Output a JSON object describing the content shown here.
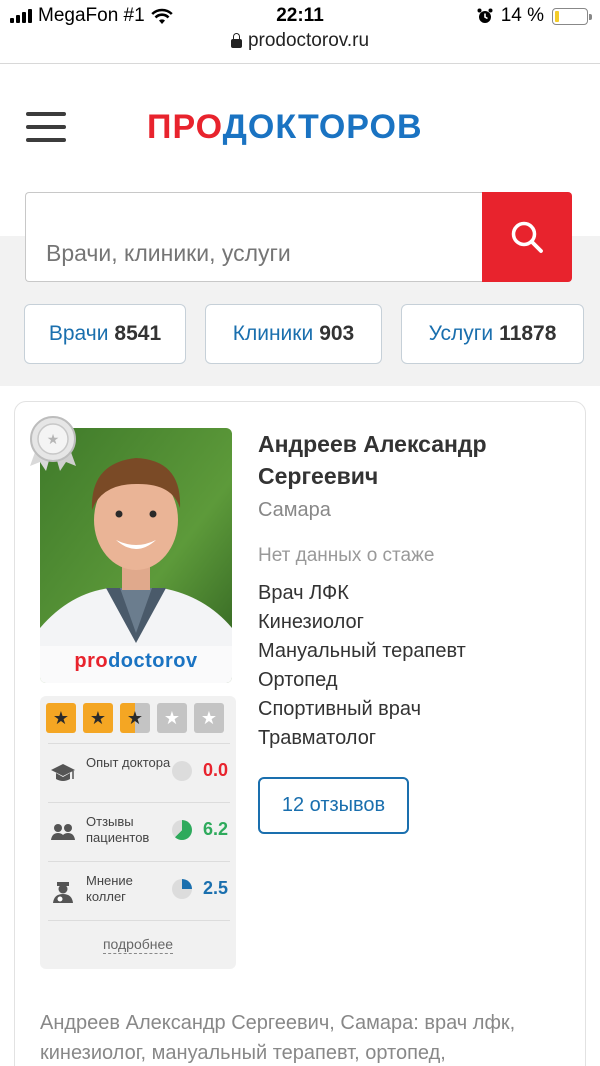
{
  "status_bar": {
    "carrier": "MegaFon #1",
    "time": "22:11",
    "battery": "14 %",
    "battery_level": 0.14,
    "url": "prodoctorov.ru"
  },
  "header": {
    "logo_part1": "ПРО",
    "logo_part2": "ДОКТОРОВ"
  },
  "search": {
    "placeholder": "Врачи, клиники, услуги"
  },
  "stats": [
    {
      "label": "Врачи",
      "count": "8541"
    },
    {
      "label": "Клиники",
      "count": "903"
    },
    {
      "label": "Услуги",
      "count": "11878"
    }
  ],
  "doctor": {
    "name": "Андреев Александр Сергеевич",
    "city": "Самара",
    "experience": "Нет данных о стаже",
    "specialties": [
      "Врач ЛФК",
      "Кинезиолог",
      "Мануальный терапевт",
      "Ортопед",
      "Спортивный врач",
      "Травматолог"
    ],
    "reviews_button": "12 отзывов",
    "photo_watermark_1": "pro",
    "photo_watermark_2": "doctorov",
    "rating_stars": 2.5,
    "metrics": [
      {
        "label": "Опыт доктора",
        "value": "0.0",
        "color": "#e8232d",
        "fill": 0.0
      },
      {
        "label": "Отзывы пациентов",
        "value": "6.2",
        "color": "#2eaa5c",
        "fill": 0.62
      },
      {
        "label": "Мнение коллег",
        "value": "2.5",
        "color": "#1a6fae",
        "fill": 0.25
      }
    ],
    "more_link": "подробнее",
    "description": "Андреев Александр Сергеевич, Самара: врач лфк, кинезиолог, мануальный терапевт, ортопед,"
  }
}
